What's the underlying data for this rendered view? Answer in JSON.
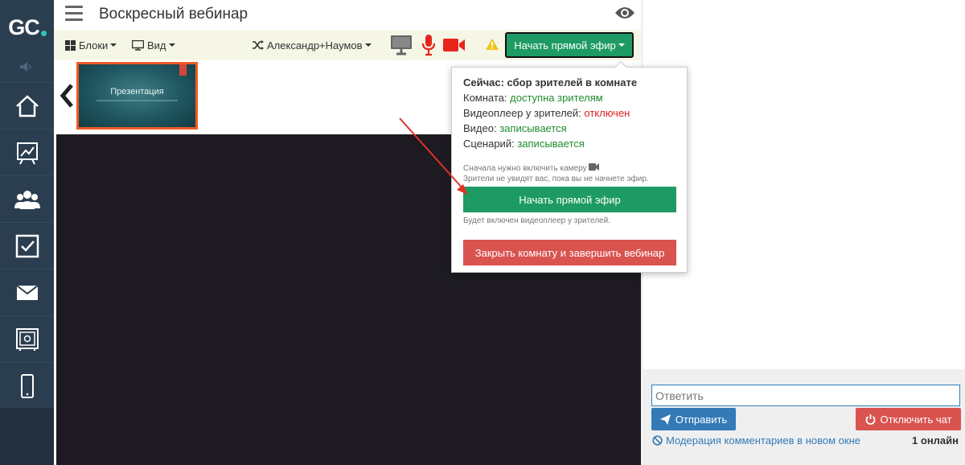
{
  "app": {
    "logo_text": "GC",
    "title": "Воскресный вебинар"
  },
  "sidebar": {
    "items": [
      {
        "icon": "home-icon"
      },
      {
        "icon": "chart-icon"
      },
      {
        "icon": "users-icon"
      },
      {
        "icon": "checkbox-icon"
      },
      {
        "icon": "mail-icon"
      },
      {
        "icon": "safe-icon"
      },
      {
        "icon": "mobile-icon"
      }
    ]
  },
  "toolbar": {
    "blocks_label": "Блоки",
    "view_label": "Вид",
    "user_label": "Александр+Наумов",
    "go_live_label": "Начать прямой эфир"
  },
  "slide": {
    "title": "Презентация"
  },
  "popup": {
    "status_label": "Сейчас: сбор зрителей в комнате",
    "room_label": "Комната:",
    "room_value": "доступна зрителям",
    "player_label": "Видеоплеер у зрителей:",
    "player_value": "отключен",
    "video_label": "Видео:",
    "video_value": "записывается",
    "script_label": "Сценарий:",
    "script_value": "записывается",
    "note_camera": "Сначала нужно включить камеру",
    "note_viewers": "Зрители не увидят вас, пока вы не начнете эфир.",
    "go_live_button": "Начать прямой эфир",
    "note_player": "Будет включен видеоплеер у зрителей.",
    "close_room_button": "Закрыть комнату и завершить вебинар"
  },
  "chat": {
    "reply_placeholder": "Ответить",
    "send_button": "Отправить",
    "disable_chat_button": "Отключить чат",
    "moderation_link": "Модерация комментариев в новом окне",
    "online_count": "1 онлайн"
  },
  "colors": {
    "sidebar_bg": "#2b3e50",
    "toolbar_bg": "#f6f6e6",
    "accent_green": "#1e9b64",
    "danger_red": "#d9534f",
    "primary_blue": "#337ab7",
    "status_green": "#1e8c2e",
    "status_red": "#e02020"
  }
}
